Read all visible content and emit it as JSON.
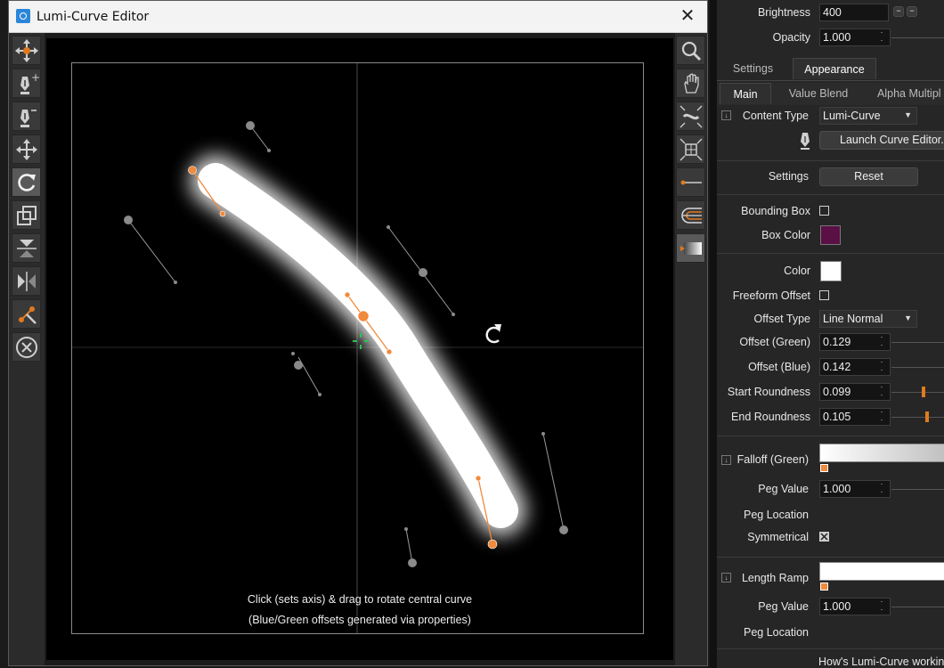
{
  "window": {
    "title": "Lumi-Curve Editor",
    "close_glyph": "✕"
  },
  "left_toolbar": {
    "items": [
      {
        "name": "move-all-tool-icon"
      },
      {
        "name": "add-point-pen-icon"
      },
      {
        "name": "remove-point-pen-icon"
      },
      {
        "name": "move-points-icon"
      },
      {
        "name": "rotate-tool-icon",
        "active": true
      },
      {
        "name": "scale-tool-icon"
      },
      {
        "name": "flip-vertical-icon"
      },
      {
        "name": "flip-horizontal-icon"
      },
      {
        "name": "edit-tangent-icon"
      },
      {
        "name": "delete-icon"
      }
    ]
  },
  "right_toolbar": {
    "items": [
      {
        "name": "zoom-icon"
      },
      {
        "name": "pan-hand-icon"
      },
      {
        "name": "fit-curve-icon"
      },
      {
        "name": "fit-frame-icon"
      },
      {
        "name": "show-line-icon"
      },
      {
        "name": "show-offset-curves-icon"
      },
      {
        "name": "show-glow-icon",
        "active": true
      }
    ]
  },
  "canvas": {
    "hint_line1": "Click (sets axis) & drag to rotate central curve",
    "hint_line2": "(Blue/Green offsets generated via properties)"
  },
  "panel": {
    "brightness": {
      "label": "Brightness",
      "value": "400"
    },
    "opacity": {
      "label": "Opacity",
      "value": "1.000"
    },
    "tabs": [
      {
        "label": "Settings"
      },
      {
        "label": "Appearance",
        "active": true
      }
    ],
    "subtabs": [
      {
        "label": "Main",
        "active": true
      },
      {
        "label": "Value Blend"
      },
      {
        "label": "Alpha Multipl"
      }
    ],
    "content_type": {
      "label": "Content Type",
      "value": "Lumi-Curve"
    },
    "launch_button": "Launch Curve Editor...",
    "settings": {
      "label": "Settings",
      "button": "Reset"
    },
    "bounding_box": {
      "label": "Bounding Box",
      "checked": false
    },
    "box_color": {
      "label": "Box Color",
      "color": "#5a0f45"
    },
    "color": {
      "label": "Color",
      "color": "#ffffff"
    },
    "freeform_offset": {
      "label": "Freeform Offset",
      "checked": false
    },
    "offset_type": {
      "label": "Offset Type",
      "value": "Line Normal"
    },
    "offset_green": {
      "label": "Offset (Green)",
      "value": "0.129"
    },
    "offset_blue": {
      "label": "Offset (Blue)",
      "value": "0.142"
    },
    "start_roundness": {
      "label": "Start Roundness",
      "value": "0.099"
    },
    "end_roundness": {
      "label": "End Roundness",
      "value": "0.105"
    },
    "falloff_green": {
      "label": "Falloff (Green)"
    },
    "peg_value_1": {
      "label": "Peg Value",
      "value": "1.000"
    },
    "peg_location_1": {
      "label": "Peg Location"
    },
    "symmetrical": {
      "label": "Symmetrical",
      "checked": true
    },
    "length_ramp": {
      "label": "Length Ramp"
    },
    "peg_value_2": {
      "label": "Peg Value",
      "value": "1.000"
    },
    "peg_location_2": {
      "label": "Peg Location"
    },
    "help_link": "How's Lumi-Curve working"
  },
  "colors": {
    "accent": "#f08a3c",
    "panel_bg": "#262626"
  }
}
